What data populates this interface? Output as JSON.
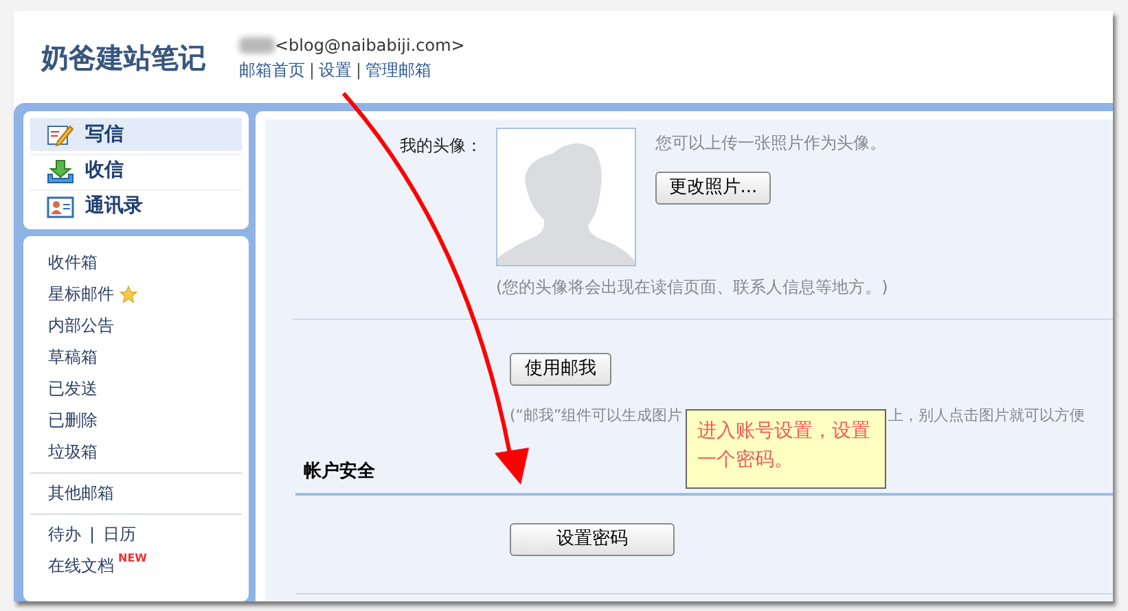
{
  "logo": "奶爸建站笔记",
  "account": {
    "email": "<blog@naibabiji.com>",
    "separator": "|",
    "links": [
      "邮箱首页",
      "设置",
      "管理邮箱"
    ]
  },
  "actions": [
    {
      "label": "写信",
      "kind": "compose",
      "selected": true
    },
    {
      "label": "收信",
      "kind": "inbox",
      "selected": false
    },
    {
      "label": "通讯录",
      "kind": "contacts",
      "selected": false
    }
  ],
  "folders": [
    {
      "label": "收件箱",
      "kind": "plain"
    },
    {
      "label": "星标邮件",
      "kind": "starred"
    },
    {
      "label": "内部公告",
      "kind": "plain"
    },
    {
      "label": "草稿箱",
      "kind": "plain"
    },
    {
      "label": "已发送",
      "kind": "plain"
    },
    {
      "label": "已删除",
      "kind": "plain"
    },
    {
      "label": "垃圾箱",
      "kind": "plain"
    }
  ],
  "other_mailbox": "其他邮箱",
  "tools": {
    "items": [
      "待办",
      "日历"
    ],
    "separator": "|"
  },
  "online_docs": {
    "label": "在线文档",
    "badge": "NEW"
  },
  "avatar": {
    "label": "我的头像：",
    "hint": "您可以上传一张照片作为头像。",
    "button": "更改照片...",
    "note": "(您的头像将会出现在读信页面、联系人信息等地方。)"
  },
  "mailme": {
    "button": "使用邮我",
    "note_parts": [
      "(“邮我”组件可以生成图片",
      "上，别人点击图片就可以方便"
    ]
  },
  "security": {
    "heading": "帐户安全",
    "button": "设置密码"
  },
  "annotation": {
    "text": "进入账号设置，设置一个密码。"
  }
}
